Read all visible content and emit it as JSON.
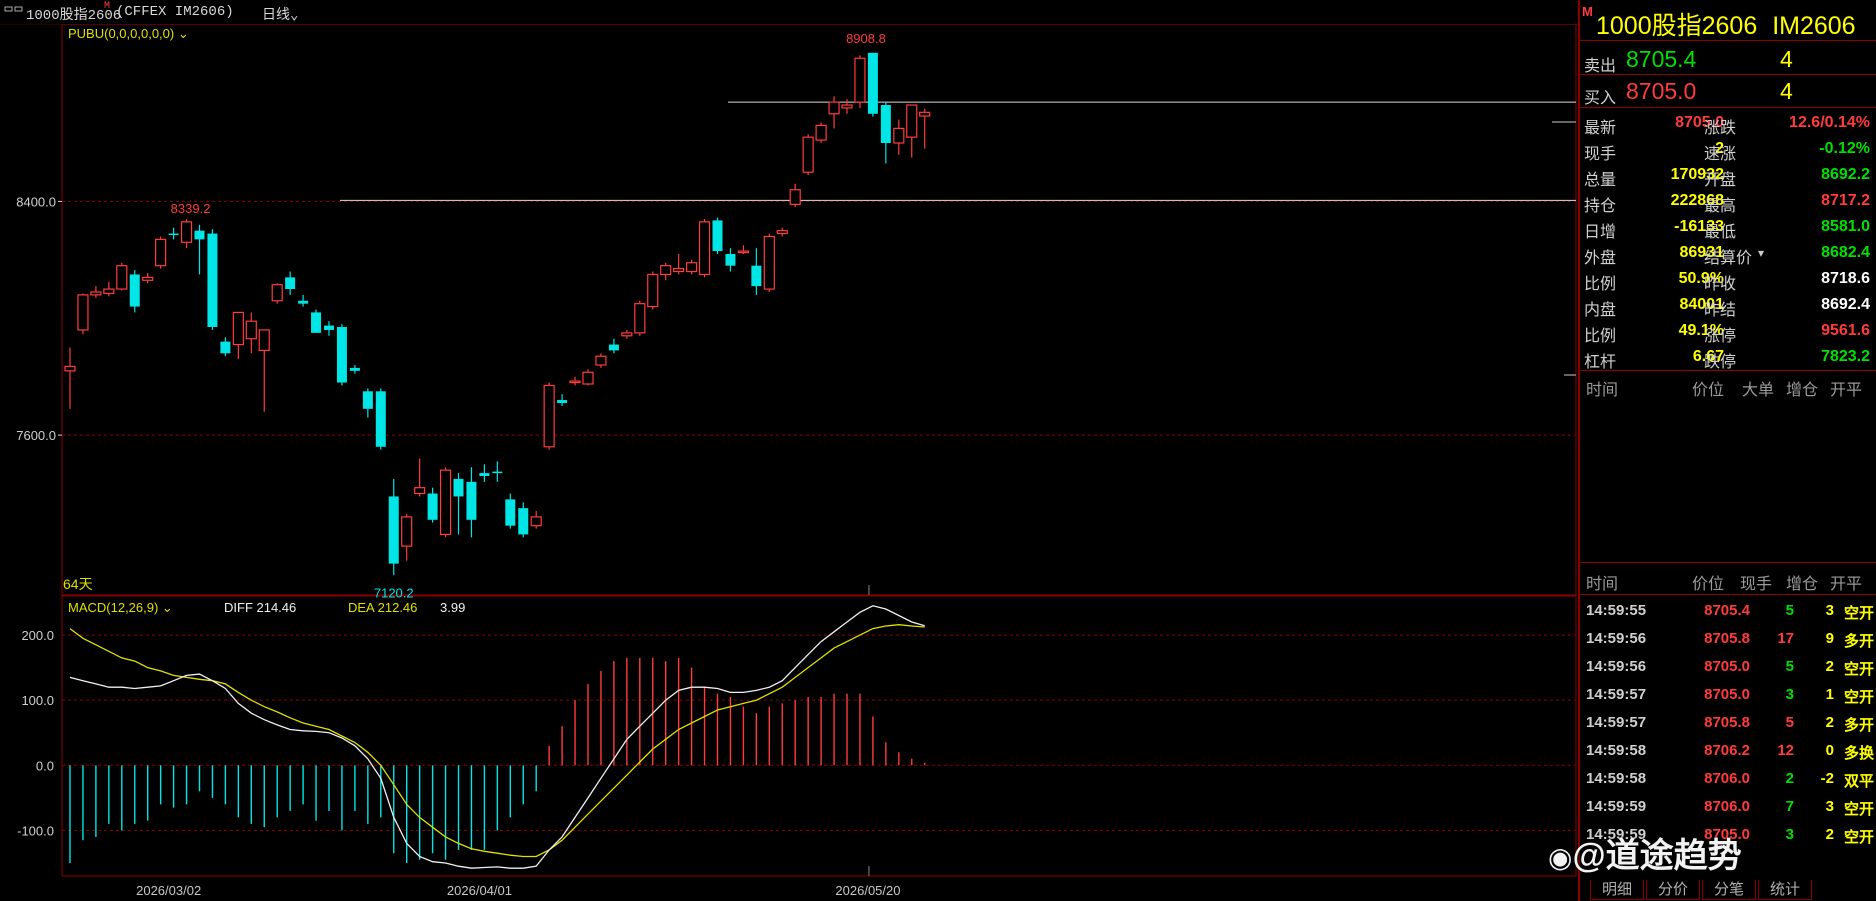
{
  "topbar": {
    "window_icon": "window-menu-icon",
    "title": "1000股指2606",
    "title_badge": "M",
    "exchange": "(CFFEX IM2606)",
    "period": "日线",
    "period_icon": "chevron-down-icon"
  },
  "main_chart": {
    "indicator_label": "PUBU(0,0,0,0,0,0)",
    "days_label": "64天",
    "price_ticks": [
      "8400.0",
      "7600.0"
    ],
    "annotations": {
      "high": "8908.8",
      "mid_high": "8339.2",
      "low": "7120.2"
    },
    "date_labels": [
      "2026/03/02",
      "2026/04/01",
      "2026/05/20"
    ]
  },
  "macd": {
    "label": "MACD(12,26,9)",
    "diff_label": "DIFF 214.46",
    "dea_label": "DEA 212.46",
    "macd_value": "3.99",
    "ticks": [
      "200.0",
      "100.0",
      "0.0",
      "-100.0"
    ]
  },
  "colors": {
    "up": "#ff3b3b",
    "down": "#00e5e5",
    "dea": "#e0e000",
    "diff": "#f0f0f0",
    "grid": "#8b0000",
    "panel_border": "#8b0000"
  },
  "chart_data": {
    "type": "candlestick",
    "candles": [
      {
        "o": 7820,
        "h": 7900,
        "l": 7690,
        "c": 7835
      },
      {
        "o": 7960,
        "h": 8085,
        "l": 7945,
        "c": 8080
      },
      {
        "o": 8080,
        "h": 8110,
        "l": 8070,
        "c": 8090
      },
      {
        "o": 8085,
        "h": 8125,
        "l": 8075,
        "c": 8100
      },
      {
        "o": 8100,
        "h": 8190,
        "l": 8095,
        "c": 8180
      },
      {
        "o": 8150,
        "h": 8165,
        "l": 8020,
        "c": 8040
      },
      {
        "o": 8130,
        "h": 8155,
        "l": 8120,
        "c": 8140
      },
      {
        "o": 8180,
        "h": 8280,
        "l": 8170,
        "c": 8270
      },
      {
        "o": 8290,
        "h": 8310,
        "l": 8270,
        "c": 8285
      },
      {
        "o": 8260,
        "h": 8339.2,
        "l": 8240,
        "c": 8330
      },
      {
        "o": 8300,
        "h": 8320,
        "l": 8150,
        "c": 8270
      },
      {
        "o": 8290,
        "h": 8305,
        "l": 7960,
        "c": 7970
      },
      {
        "o": 7920,
        "h": 7935,
        "l": 7870,
        "c": 7880
      },
      {
        "o": 7910,
        "h": 8020,
        "l": 7860,
        "c": 8020
      },
      {
        "o": 7930,
        "h": 8020,
        "l": 7880,
        "c": 7990
      },
      {
        "o": 7890,
        "h": 7960,
        "l": 7680,
        "c": 7960
      },
      {
        "o": 8060,
        "h": 8120,
        "l": 8050,
        "c": 8115
      },
      {
        "o": 8140,
        "h": 8160,
        "l": 8080,
        "c": 8100
      },
      {
        "o": 8060,
        "h": 8080,
        "l": 8040,
        "c": 8050
      },
      {
        "o": 8020,
        "h": 8030,
        "l": 7950,
        "c": 7950
      },
      {
        "o": 7975,
        "h": 7990,
        "l": 7940,
        "c": 7960
      },
      {
        "o": 7970,
        "h": 7980,
        "l": 7770,
        "c": 7780
      },
      {
        "o": 7830,
        "h": 7840,
        "l": 7810,
        "c": 7820
      },
      {
        "o": 7750,
        "h": 7760,
        "l": 7660,
        "c": 7690
      },
      {
        "o": 7750,
        "h": 7760,
        "l": 7550,
        "c": 7560
      },
      {
        "o": 7390,
        "h": 7450,
        "l": 7120.2,
        "c": 7160
      },
      {
        "o": 7220,
        "h": 7330,
        "l": 7170,
        "c": 7320
      },
      {
        "o": 7400,
        "h": 7520,
        "l": 7390,
        "c": 7420
      },
      {
        "o": 7400,
        "h": 7420,
        "l": 7300,
        "c": 7310
      },
      {
        "o": 7260,
        "h": 7490,
        "l": 7250,
        "c": 7480
      },
      {
        "o": 7450,
        "h": 7470,
        "l": 7260,
        "c": 7390
      },
      {
        "o": 7440,
        "h": 7490,
        "l": 7250,
        "c": 7310
      },
      {
        "o": 7470,
        "h": 7500,
        "l": 7440,
        "c": 7460
      },
      {
        "o": 7475,
        "h": 7510,
        "l": 7440,
        "c": 7470
      },
      {
        "o": 7380,
        "h": 7400,
        "l": 7280,
        "c": 7290
      },
      {
        "o": 7350,
        "h": 7370,
        "l": 7250,
        "c": 7260
      },
      {
        "o": 7290,
        "h": 7340,
        "l": 7280,
        "c": 7320
      },
      {
        "o": 7560,
        "h": 7780,
        "l": 7550,
        "c": 7770
      },
      {
        "o": 7720,
        "h": 7740,
        "l": 7700,
        "c": 7710
      },
      {
        "o": 7780,
        "h": 7800,
        "l": 7770,
        "c": 7785
      },
      {
        "o": 7775,
        "h": 7825,
        "l": 7770,
        "c": 7815
      },
      {
        "o": 7840,
        "h": 7880,
        "l": 7830,
        "c": 7870
      },
      {
        "o": 7910,
        "h": 7930,
        "l": 7880,
        "c": 7890
      },
      {
        "o": 7940,
        "h": 7960,
        "l": 7930,
        "c": 7950
      },
      {
        "o": 7950,
        "h": 8060,
        "l": 7940,
        "c": 8050
      },
      {
        "o": 8040,
        "h": 8160,
        "l": 8030,
        "c": 8150
      },
      {
        "o": 8150,
        "h": 8190,
        "l": 8130,
        "c": 8180
      },
      {
        "o": 8160,
        "h": 8220,
        "l": 8150,
        "c": 8170
      },
      {
        "o": 8160,
        "h": 8200,
        "l": 8150,
        "c": 8190
      },
      {
        "o": 8150,
        "h": 8340,
        "l": 8140,
        "c": 8330
      },
      {
        "o": 8335,
        "h": 8345,
        "l": 8220,
        "c": 8230
      },
      {
        "o": 8220,
        "h": 8240,
        "l": 8160,
        "c": 8180
      },
      {
        "o": 8230,
        "h": 8250,
        "l": 8220,
        "c": 8230
      },
      {
        "o": 8180,
        "h": 8240,
        "l": 8080,
        "c": 8110
      },
      {
        "o": 8100,
        "h": 8290,
        "l": 8090,
        "c": 8280
      },
      {
        "o": 8290,
        "h": 8310,
        "l": 8280,
        "c": 8300
      },
      {
        "o": 8390,
        "h": 8460,
        "l": 8380,
        "c": 8440
      },
      {
        "o": 8500,
        "h": 8630,
        "l": 8490,
        "c": 8620
      },
      {
        "o": 8610,
        "h": 8670,
        "l": 8600,
        "c": 8660
      },
      {
        "o": 8700,
        "h": 8760,
        "l": 8650,
        "c": 8740
      },
      {
        "o": 8720,
        "h": 8750,
        "l": 8700,
        "c": 8730
      },
      {
        "o": 8740,
        "h": 8900,
        "l": 8720,
        "c": 8890
      },
      {
        "o": 8908.8,
        "h": 8908.8,
        "l": 8690,
        "c": 8700
      },
      {
        "o": 8730,
        "h": 8740,
        "l": 8530,
        "c": 8600
      },
      {
        "o": 8600,
        "h": 8680,
        "l": 8560,
        "c": 8650
      },
      {
        "o": 8620,
        "h": 8730,
        "l": 8550,
        "c": 8730
      },
      {
        "o": 8692.2,
        "h": 8717.2,
        "l": 8581.0,
        "c": 8705.0
      }
    ],
    "price_lines": [
      8400,
      7600
    ],
    "macd_hist": [
      -150,
      -115,
      -110,
      -90,
      -100,
      -90,
      -85,
      -60,
      -65,
      -60,
      -40,
      -50,
      -60,
      -80,
      -90,
      -95,
      -80,
      -70,
      -60,
      -85,
      -70,
      -100,
      -70,
      -90,
      -80,
      -135,
      -150,
      -145,
      -135,
      -145,
      -130,
      -130,
      -130,
      -100,
      -80,
      -60,
      -40,
      30,
      60,
      100,
      125,
      145,
      160,
      165,
      165,
      165,
      160,
      165,
      150,
      120,
      110,
      105,
      90,
      80,
      90,
      95,
      100,
      105,
      105,
      110,
      110,
      110,
      75,
      35,
      20,
      10,
      4
    ],
    "macd_dea": [
      210,
      195,
      185,
      175,
      165,
      160,
      150,
      145,
      138,
      135,
      132,
      130,
      125,
      112,
      100,
      90,
      82,
      73,
      65,
      60,
      55,
      45,
      35,
      20,
      0,
      -30,
      -60,
      -80,
      -95,
      -110,
      -120,
      -128,
      -132,
      -135,
      -138,
      -140,
      -140,
      -130,
      -115,
      -95,
      -75,
      -55,
      -35,
      -15,
      5,
      25,
      40,
      55,
      65,
      75,
      85,
      90,
      95,
      100,
      110,
      120,
      135,
      150,
      165,
      180,
      190,
      200,
      210,
      214,
      216,
      214,
      212.46
    ],
    "macd_diff": [
      135,
      130,
      125,
      120,
      120,
      118,
      120,
      122,
      130,
      138,
      140,
      130,
      118,
      95,
      80,
      70,
      62,
      55,
      53,
      52,
      50,
      42,
      30,
      10,
      -20,
      -80,
      -120,
      -140,
      -148,
      -150,
      -155,
      -158,
      -157,
      -156,
      -158,
      -158,
      -155,
      -130,
      -110,
      -80,
      -50,
      -20,
      10,
      40,
      60,
      80,
      100,
      115,
      120,
      120,
      118,
      112,
      112,
      115,
      120,
      130,
      150,
      170,
      190,
      205,
      220,
      235,
      245,
      240,
      230,
      220,
      214.46
    ],
    "macd_ylim": [
      -170,
      260
    ],
    "price_ylim": [
      7080,
      8980
    ]
  },
  "panel": {
    "badge": "M",
    "title": "1000股指2606",
    "code": "IM2606",
    "sell_label": "卖出",
    "sell_price": "8705.4",
    "sell_qty": "4",
    "buy_label": "买入",
    "buy_price": "8705.0",
    "buy_qty": "4",
    "stats": [
      {
        "l1": "最新",
        "v1": "8705.0",
        "c1": "red",
        "l2": "涨跌",
        "v2": "12.6/0.14%",
        "c2": "red"
      },
      {
        "l1": "现手",
        "v1": "2",
        "c1": "yel",
        "l2": "速涨",
        "v2": "-0.12%",
        "c2": "grn"
      },
      {
        "l1": "总量",
        "v1": "170932",
        "c1": "yel",
        "l2": "开盘",
        "v2": "8692.2",
        "c2": "grn"
      },
      {
        "l1": "持仓",
        "v1": "222868",
        "c1": "yel",
        "l2": "最高",
        "v2": "8717.2",
        "c2": "red"
      },
      {
        "l1": "日增",
        "v1": "-16133",
        "c1": "yel",
        "l2": "最低",
        "v2": "8581.0",
        "c2": "grn"
      },
      {
        "l1": "外盘",
        "v1": "86931",
        "c1": "yel",
        "l2": "结算价",
        "v2": "8682.4",
        "c2": "grn"
      },
      {
        "l1": "比例",
        "v1": "50.9%",
        "c1": "yel",
        "l2": "昨收",
        "v2": "8718.6",
        "c2": "wht"
      },
      {
        "l1": "内盘",
        "v1": "84001",
        "c1": "yel",
        "l2": "昨结",
        "v2": "8692.4",
        "c2": "wht"
      },
      {
        "l1": "比例",
        "v1": "49.1%",
        "c1": "yel",
        "l2": "涨停",
        "v2": "9561.6",
        "c2": "red"
      },
      {
        "l1": "杠杆",
        "v1": "6.67",
        "c1": "yel",
        "l2": "跌停",
        "v2": "7823.2",
        "c2": "grn"
      }
    ],
    "big_header": {
      "time": "时间",
      "price": "价位",
      "big": "大单",
      "inc": "增仓",
      "type": "开平"
    },
    "tick_header": {
      "time": "时间",
      "price": "价位",
      "qty": "现手",
      "inc": "增仓",
      "type": "开平"
    },
    "ticks": [
      {
        "time": "14:59:55",
        "price": "8705.4",
        "qty": "5",
        "inc": "3",
        "type": "空开",
        "pc": "red",
        "qc": "grn",
        "tc": "yel"
      },
      {
        "time": "14:59:56",
        "price": "8705.8",
        "qty": "17",
        "inc": "9",
        "type": "多开",
        "pc": "red",
        "qc": "red",
        "tc": "yel"
      },
      {
        "time": "14:59:56",
        "price": "8705.0",
        "qty": "5",
        "inc": "2",
        "type": "空开",
        "pc": "red",
        "qc": "grn",
        "tc": "yel"
      },
      {
        "time": "14:59:57",
        "price": "8705.0",
        "qty": "3",
        "inc": "1",
        "type": "空开",
        "pc": "red",
        "qc": "grn",
        "tc": "yel"
      },
      {
        "time": "14:59:57",
        "price": "8705.8",
        "qty": "5",
        "inc": "2",
        "type": "多开",
        "pc": "red",
        "qc": "red",
        "tc": "yel"
      },
      {
        "time": "14:59:58",
        "price": "8706.2",
        "qty": "12",
        "inc": "0",
        "type": "多换",
        "pc": "red",
        "qc": "red",
        "tc": "yel"
      },
      {
        "time": "14:59:58",
        "price": "8706.0",
        "qty": "2",
        "inc": "-2",
        "type": "双平",
        "pc": "red",
        "qc": "grn",
        "tc": "yel"
      },
      {
        "time": "14:59:59",
        "price": "8706.0",
        "qty": "7",
        "inc": "3",
        "type": "空开",
        "pc": "red",
        "qc": "grn",
        "tc": "yel"
      },
      {
        "time": "14:59:59",
        "price": "8705.0",
        "qty": "3",
        "inc": "2",
        "type": "空开",
        "pc": "red",
        "qc": "grn",
        "tc": "yel"
      }
    ],
    "tabs": [
      "明细",
      "分价",
      "分笔",
      "统计"
    ],
    "watermark": "@道途趋势",
    "watermark_icon": "weibo-logo-icon"
  }
}
